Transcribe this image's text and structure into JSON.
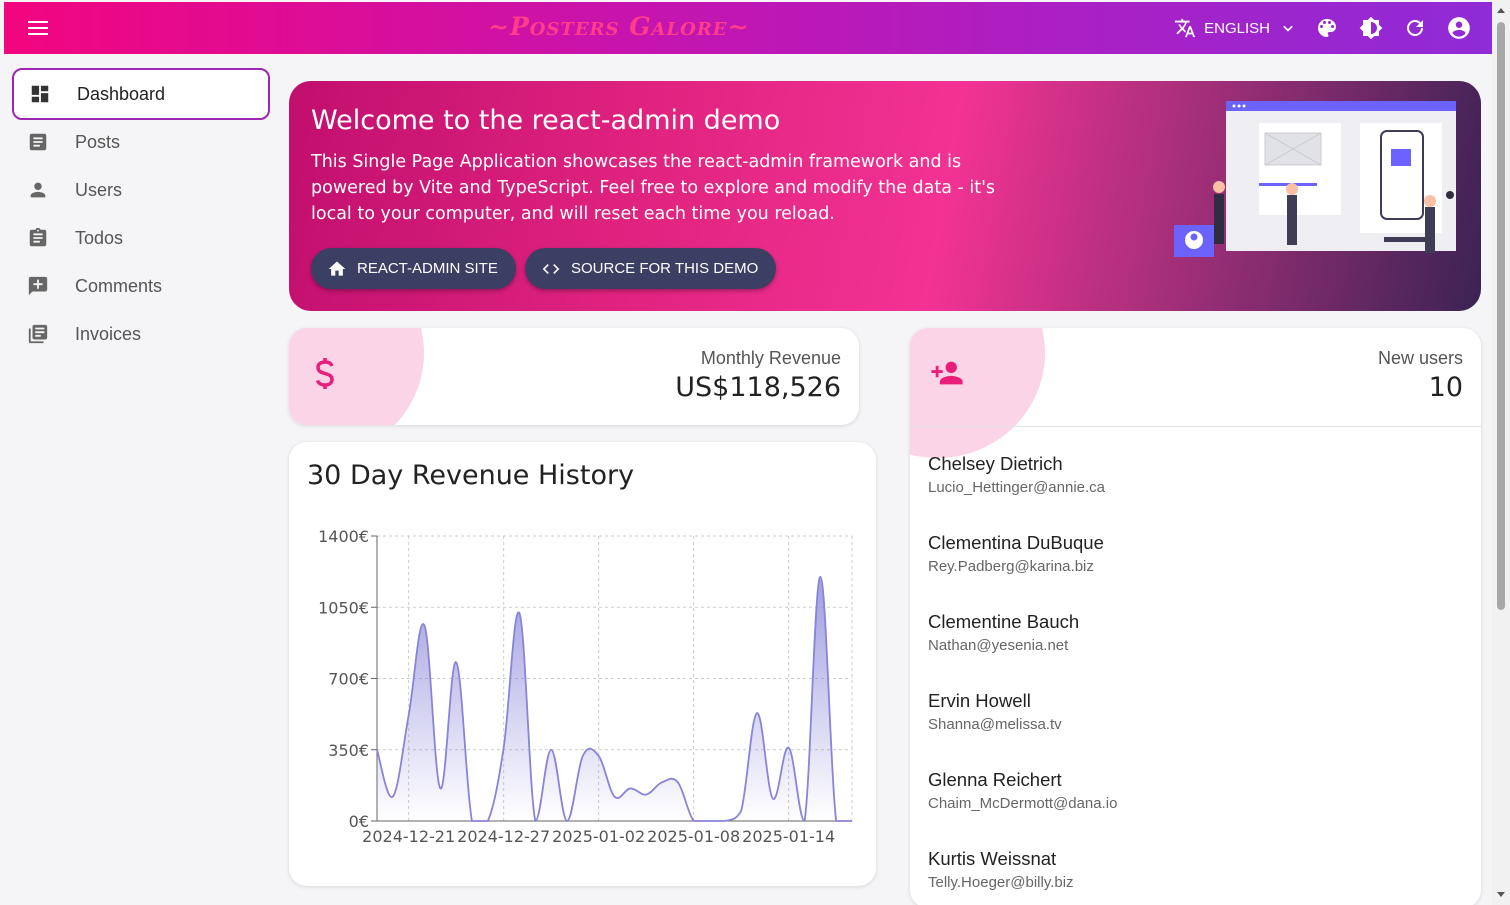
{
  "appbar": {
    "brand": "~Posters Galore~",
    "language": "ENGLISH",
    "icons": [
      "menu-icon",
      "translate-icon",
      "chevron-down-icon",
      "palette-icon",
      "brightness-icon",
      "refresh-icon",
      "account-icon"
    ]
  },
  "sidebar": {
    "items": [
      {
        "label": "Dashboard",
        "icon": "dashboard-icon",
        "active": true
      },
      {
        "label": "Posts",
        "icon": "article-icon"
      },
      {
        "label": "Users",
        "icon": "person-icon"
      },
      {
        "label": "Todos",
        "icon": "clipboard-icon"
      },
      {
        "label": "Comments",
        "icon": "comment-icon"
      },
      {
        "label": "Invoices",
        "icon": "library-books-icon"
      }
    ]
  },
  "welcome": {
    "title": "Welcome to the react-admin demo",
    "body": "This Single Page Application showcases the react-admin framework and is powered by Vite and TypeScript. Feel free to explore and modify the data - it's local to your computer, and will reset each time you reload.",
    "btn_site": "REACT-ADMIN SITE",
    "btn_source": "SOURCE FOR THIS DEMO"
  },
  "revenue": {
    "label": "Monthly Revenue",
    "value": "US$118,526",
    "icon": "dollar-icon"
  },
  "new_users": {
    "label": "New users",
    "value": "10",
    "icon": "person-add-icon",
    "users": [
      {
        "name": "Chelsey Dietrich",
        "email": "Lucio_Hettinger@annie.ca"
      },
      {
        "name": "Clementina DuBuque",
        "email": "Rey.Padberg@karina.biz"
      },
      {
        "name": "Clementine Bauch",
        "email": "Nathan@yesenia.net"
      },
      {
        "name": "Ervin Howell",
        "email": "Shanna@melissa.tv"
      },
      {
        "name": "Glenna Reichert",
        "email": "Chaim_McDermott@dana.io"
      },
      {
        "name": "Kurtis Weissnat",
        "email": "Telly.Hoeger@billy.biz"
      }
    ]
  },
  "colors": {
    "accent": "#f2067f",
    "line": "#8884d8",
    "sidebar_active": "#9c27b0",
    "button": "#3a3f63"
  },
  "chart_data": {
    "type": "area",
    "title": "30 Day Revenue History",
    "xlabel": "",
    "ylabel": "",
    "x": [
      "2024-12-19",
      "2024-12-20",
      "2024-12-21",
      "2024-12-22",
      "2024-12-23",
      "2024-12-24",
      "2024-12-25",
      "2024-12-26",
      "2024-12-27",
      "2024-12-28",
      "2024-12-29",
      "2024-12-30",
      "2024-12-31",
      "2025-01-01",
      "2025-01-02",
      "2025-01-03",
      "2025-01-04",
      "2025-01-05",
      "2025-01-06",
      "2025-01-07",
      "2025-01-08",
      "2025-01-09",
      "2025-01-10",
      "2025-01-11",
      "2025-01-12",
      "2025-01-13",
      "2025-01-14",
      "2025-01-15",
      "2025-01-16",
      "2025-01-17",
      "2025-01-18"
    ],
    "values": [
      350,
      120,
      520,
      960,
      160,
      780,
      0,
      0,
      360,
      1020,
      0,
      350,
      0,
      320,
      320,
      120,
      160,
      130,
      190,
      190,
      0,
      0,
      0,
      50,
      530,
      110,
      360,
      0,
      1200,
      0,
      0
    ],
    "x_ticks": [
      "2024-12-21",
      "2024-12-27",
      "2025-01-02",
      "2025-01-08",
      "2025-01-14"
    ],
    "y_ticks": [
      "0€",
      "350€",
      "700€",
      "1050€",
      "1400€"
    ],
    "ylim": [
      0,
      1400
    ],
    "grid": true
  }
}
